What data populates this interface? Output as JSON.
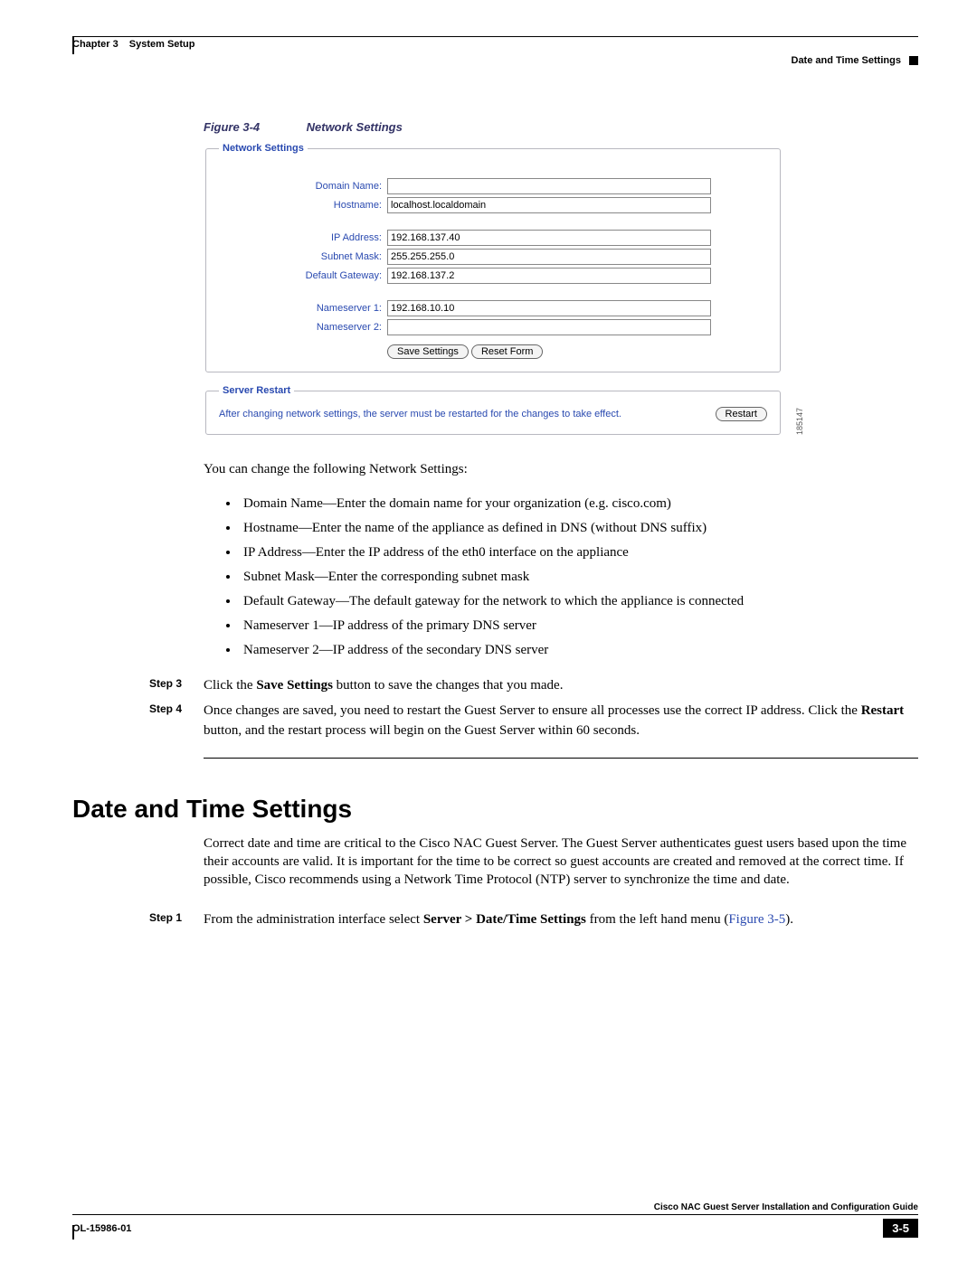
{
  "header": {
    "chapter_label": "Chapter 3",
    "chapter_title": "System Setup",
    "section_subtitle": "Date and Time Settings"
  },
  "figure": {
    "label": "Figure 3-4",
    "title": "Network Settings",
    "image_id": "185147",
    "network_settings": {
      "legend": "Network Settings",
      "fields": {
        "domain_name": {
          "label": "Domain Name:",
          "value": ""
        },
        "hostname": {
          "label": "Hostname:",
          "value": "localhost.localdomain"
        },
        "ip_address": {
          "label": "IP Address:",
          "value": "192.168.137.40"
        },
        "subnet_mask": {
          "label": "Subnet Mask:",
          "value": "255.255.255.0"
        },
        "default_gw": {
          "label": "Default Gateway:",
          "value": "192.168.137.2"
        },
        "ns1": {
          "label": "Nameserver 1:",
          "value": "192.168.10.10"
        },
        "ns2": {
          "label": "Nameserver 2:",
          "value": ""
        }
      },
      "buttons": {
        "save": "Save Settings",
        "reset": "Reset Form"
      }
    },
    "server_restart": {
      "legend": "Server Restart",
      "note": "After changing network settings, the server must be restarted for the changes to take effect.",
      "button": "Restart"
    }
  },
  "body": {
    "intro": "You can change the following Network Settings:",
    "bullets": [
      "Domain Name—Enter the domain name for your organization (e.g. cisco.com)",
      "Hostname—Enter the name of the appliance as defined in DNS (without DNS suffix)",
      "IP Address—Enter the IP address of the eth0 interface on the appliance",
      "Subnet Mask—Enter the corresponding subnet mask",
      "Default Gateway—The default gateway for the network to which the appliance is connected",
      "Nameserver 1—IP address of the primary DNS server",
      "Nameserver 2—IP address of the secondary DNS server"
    ],
    "steps_a": [
      {
        "label": "Step 3",
        "text_before": "Click the ",
        "bold": "Save Settings",
        "text_after": " button to save the changes that you made."
      },
      {
        "label": "Step 4",
        "text_before": "Once changes are saved, you need to restart the Guest Server to ensure all processes use the correct IP address. Click the ",
        "bold": "Restart",
        "text_after": " button, and the restart process will begin on the Guest Server within 60 seconds."
      }
    ]
  },
  "section2": {
    "heading": "Date and Time Settings",
    "para": "Correct date and time are critical to the Cisco NAC Guest Server. The Guest Server authenticates guest users based upon the time their accounts are valid. It is important for the time to be correct so guest accounts are created and removed at the correct time. If possible, Cisco recommends using a Network Time Protocol (NTP) server to synchronize the time and date.",
    "step": {
      "label": "Step 1",
      "text_before": "From the administration interface select ",
      "bold": "Server > Date/Time Settings",
      "text_after": " from the left hand menu (",
      "xref": "Figure 3-5",
      "tail": ")."
    }
  },
  "footer": {
    "guide": "Cisco NAC Guest Server Installation and Configuration Guide",
    "docnum": "OL-15986-01",
    "page": "3-5"
  }
}
